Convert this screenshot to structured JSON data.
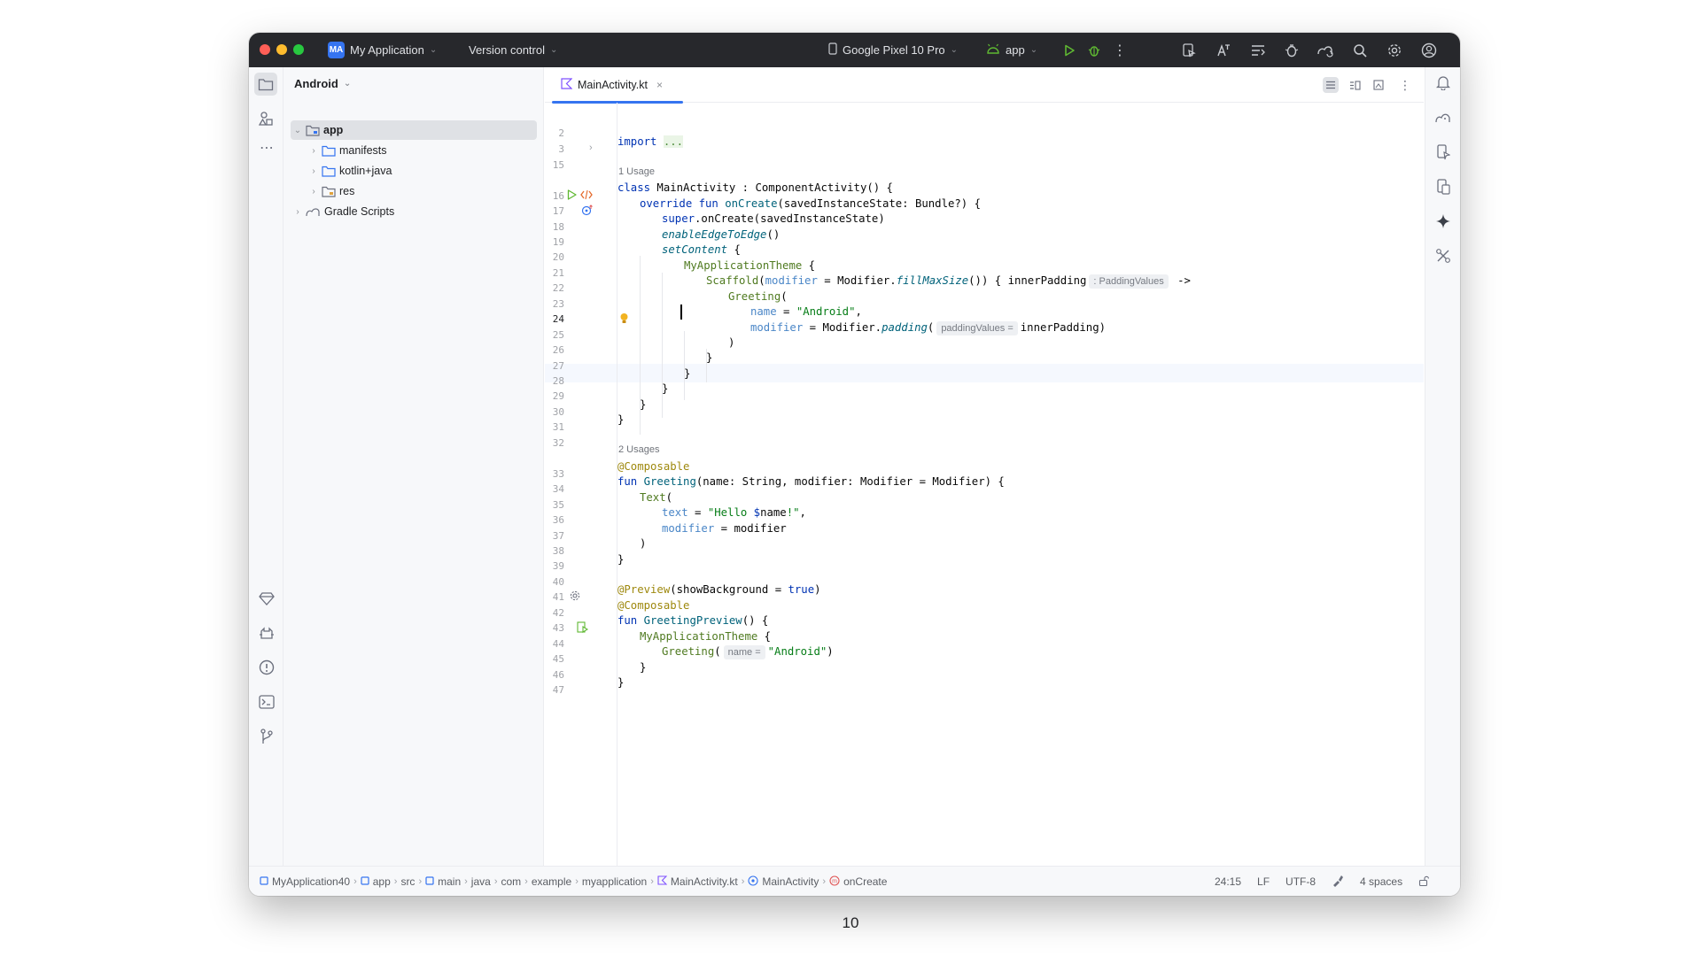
{
  "titlebar": {
    "project_badge": "MA",
    "project_name": "My Application",
    "version_control": "Version control",
    "device": "Google Pixel 10 Pro",
    "run_config": "app"
  },
  "project_panel": {
    "view_name": "Android",
    "tree": [
      {
        "label": "app",
        "level": 0,
        "expanded": true,
        "selected": true,
        "icon": "module-folder-icon"
      },
      {
        "label": "manifests",
        "level": 1,
        "expanded": false,
        "icon": "folder-icon"
      },
      {
        "label": "kotlin+java",
        "level": 1,
        "expanded": false,
        "icon": "folder-icon"
      },
      {
        "label": "res",
        "level": 1,
        "expanded": false,
        "icon": "res-folder-icon"
      },
      {
        "label": "Gradle Scripts",
        "level": 0,
        "expanded": false,
        "icon": "gradle-icon"
      }
    ]
  },
  "editor": {
    "tab_label": "MainActivity.kt",
    "usages": [
      "1 Usage",
      "2 Usages"
    ],
    "line_numbers": [
      "2",
      "3",
      "15",
      "16",
      "17",
      "18",
      "19",
      "20",
      "21",
      "22",
      "23",
      "24",
      "25",
      "26",
      "27",
      "28",
      "29",
      "30",
      "31",
      "32",
      "33",
      "34",
      "35",
      "36",
      "37",
      "38",
      "39",
      "40",
      "41",
      "42",
      "43",
      "44",
      "45",
      "46",
      "47"
    ],
    "current_line": "24",
    "code": {
      "l3_kw": "import",
      "l3_fold": "...",
      "l16_a": "class",
      "l16_b": " MainActivity : ComponentActivity() {",
      "l17_a": "override fun",
      "l17_b": "onCreate",
      "l17_c": "(savedInstanceState: Bundle?) {",
      "l18_a": "super",
      "l18_b": ".onCreate(savedInstanceState)",
      "l19_a": "enableEdgeToEdge",
      "l19_b": "()",
      "l20_a": "setContent",
      "l20_b": " {",
      "l21_a": "MyApplicationTheme",
      "l21_b": " {",
      "l22_a": "Scaffold",
      "l22_b": "(",
      "l22_c": "modifier",
      "l22_d": " = Modifier.",
      "l22_e": "fillMaxSize",
      "l22_f": "()) { innerPadding",
      "l22_hint": ": PaddingValues",
      "l22_g": " ->",
      "l23_a": "Greeting",
      "l23_b": "(",
      "l24_a": "name",
      "l24_b": " = ",
      "l24_c": "\"Android\"",
      "l24_d": ",",
      "l25_a": "modifier",
      "l25_b": " = Modifier.",
      "l25_c": "padding",
      "l25_d": "(",
      "l25_hint": "paddingValues =",
      "l25_e": "innerPadding)",
      "l26": ")",
      "l27": "}",
      "l28": "}",
      "l29": "}",
      "l30": "}",
      "l31": "}",
      "l33": "@Composable",
      "l34_a": "fun",
      "l34_b": "Greeting",
      "l34_c": "(name: String, modifier: Modifier = Modifier) {",
      "l35_a": "Text",
      "l35_b": "(",
      "l36_a": "text",
      "l36_b": " = ",
      "l36_c": "\"Hello ",
      "l36_d": "$",
      "l36_e": "name",
      "l36_f": "!\"",
      "l36_g": ",",
      "l37_a": "modifier",
      "l37_b": " = modifier",
      "l38": ")",
      "l39": "}",
      "l41_a": "@Preview",
      "l41_b": "(showBackground = ",
      "l41_c": "true",
      "l41_d": ")",
      "l42": "@Composable",
      "l43_a": "fun",
      "l43_b": "GreetingPreview",
      "l43_c": "() {",
      "l44_a": "MyApplicationTheme",
      "l44_b": " {",
      "l45_a": "Greeting",
      "l45_b": "(",
      "l45_hint": "name =",
      "l45_c": "\"Android\"",
      "l45_d": ")",
      "l46": "}",
      "l47": "}"
    }
  },
  "statusbar": {
    "breadcrumbs": [
      "MyApplication40",
      "app",
      "src",
      "main",
      "java",
      "com",
      "example",
      "myapplication",
      "MainActivity.kt",
      "MainActivity",
      "onCreate"
    ],
    "position": "24:15",
    "line_separator": "LF",
    "encoding": "UTF-8",
    "indent": "4 spaces"
  },
  "page_number": "10",
  "colors": {
    "accent": "#3574f0",
    "titlebar_bg": "#27282c",
    "keyword": "#0033b3",
    "string": "#067d17",
    "annotation": "#9e880d",
    "close": "#ff5f57",
    "minimize": "#febc2e",
    "maximize": "#28c840"
  }
}
